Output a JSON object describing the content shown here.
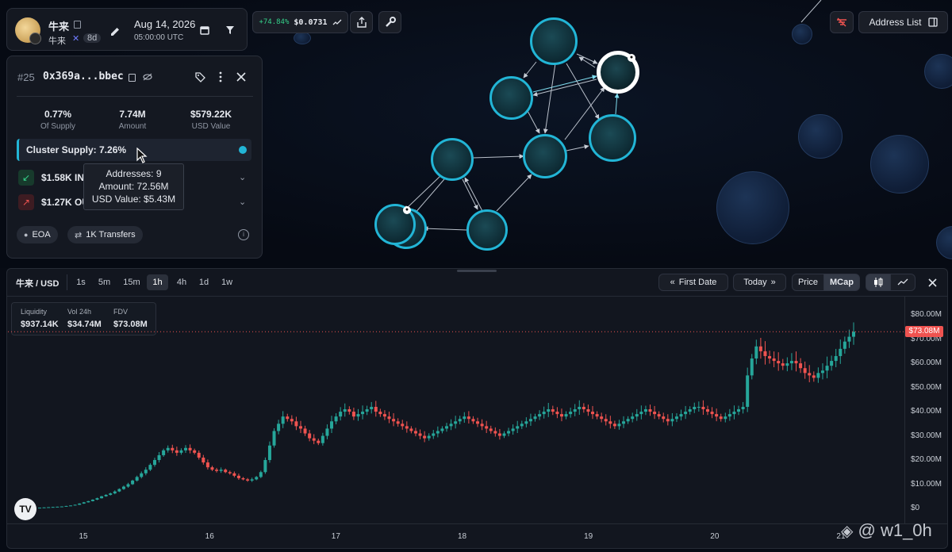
{
  "token": {
    "symbol": "牛来",
    "sub_symbol": "牛来",
    "age": "8d"
  },
  "date": {
    "day": "Aug 14, 2026",
    "time": "05:00:00 UTC"
  },
  "price_pill": {
    "change": "+74.84%",
    "price": "$0.0731"
  },
  "top_right": {
    "address_list": "Address List"
  },
  "holder": {
    "rank": "#25",
    "address": "0x369a...bbec",
    "stats": [
      {
        "value": "0.77%",
        "label": "Of Supply"
      },
      {
        "value": "7.74M",
        "label": "Amount"
      },
      {
        "value": "$579.22K",
        "label": "USD Value"
      }
    ],
    "cluster_supply": "Cluster Supply: 7.26%",
    "inflow": "$1.58K IN",
    "outflow": "$1.27K OU",
    "tooltip": {
      "addresses": "Addresses: 9",
      "amount": "Amount: 72.56M",
      "usd": "USD Value: $5.43M"
    },
    "tags": [
      "EOA",
      "1K Transfers"
    ]
  },
  "chart_toolbar": {
    "pair": "牛来 / USD",
    "timeframes": [
      "1s",
      "5m",
      "15m",
      "1h",
      "4h",
      "1d",
      "1w"
    ],
    "active_timeframe": "1h",
    "first_date": "First Date",
    "today": "Today",
    "price": "Price",
    "mcap": "MCap"
  },
  "chart_info": {
    "liquidity_label": "Liquidity",
    "liquidity": "$937.14K",
    "vol_label": "Vol 24h",
    "vol": "$34.74M",
    "fdv_label": "FDV",
    "fdv": "$73.08M"
  },
  "chart_data": {
    "type": "candlestick",
    "title": "",
    "y_unit": "USD (Market Cap)",
    "ylim": [
      0,
      83
    ],
    "y_ticks": [
      "$0",
      "$10.00M",
      "$20.00M",
      "$30.00M",
      "$40.00M",
      "$50.00M",
      "$60.00M",
      "$70.00M",
      "$80.00M"
    ],
    "y_tick_values": [
      0,
      10,
      20,
      30,
      40,
      50,
      60,
      70,
      80
    ],
    "x_ticks": [
      "15",
      "16",
      "17",
      "18",
      "19",
      "20",
      "21"
    ],
    "x_tick_positions": [
      1.0,
      2.0,
      3.0,
      4.0,
      5.0,
      6.0,
      7.0
    ],
    "xlim": [
      0.4,
      7.5
    ],
    "current_value_label": "$73.08M",
    "current_value": 73.08,
    "up_color": "#26a69a",
    "down_color": "#ef5350",
    "candles_close": [
      0.3,
      0.4,
      0.5,
      0.6,
      0.7,
      0.8,
      1.0,
      1.2,
      1.5,
      2,
      2.5,
      3,
      3.6,
      4.2,
      5,
      5.6,
      6.2,
      7,
      8,
      9,
      10,
      11.5,
      13,
      14.5,
      16,
      18,
      20,
      22,
      24,
      25,
      24,
      23,
      24,
      25,
      24,
      23,
      21,
      19,
      17,
      16,
      15.5,
      16,
      15,
      14.5,
      13.5,
      12.5,
      12,
      11.5,
      12,
      13,
      15,
      20,
      26,
      32,
      35,
      38,
      37,
      36,
      34,
      33,
      31,
      29,
      28,
      27,
      30,
      33,
      36,
      38,
      40,
      41,
      40,
      38,
      39,
      40,
      41,
      42,
      40,
      39,
      38,
      37,
      36,
      35,
      34,
      33,
      32,
      31,
      30,
      29,
      30,
      31,
      32,
      33,
      34,
      35,
      36,
      37,
      38,
      37,
      36,
      35,
      34,
      33,
      32,
      31,
      30,
      31,
      32,
      33,
      34,
      35,
      36,
      37,
      38,
      39,
      40,
      41,
      40,
      39,
      38,
      39,
      40,
      41,
      42,
      41,
      40,
      39,
      38,
      37,
      36,
      35,
      34,
      35,
      36,
      37,
      38,
      39,
      40,
      41,
      40,
      39,
      38,
      37,
      36,
      37,
      38,
      39,
      40,
      41,
      42,
      42,
      41,
      40,
      39,
      38,
      37,
      38,
      39,
      40,
      41,
      42,
      55,
      62,
      67,
      65,
      63,
      62,
      61,
      60,
      59,
      60,
      61,
      60,
      58,
      56,
      55,
      54,
      56,
      57,
      59,
      61,
      63,
      66,
      69,
      71,
      73.08
    ],
    "series_note": ""
  }
}
